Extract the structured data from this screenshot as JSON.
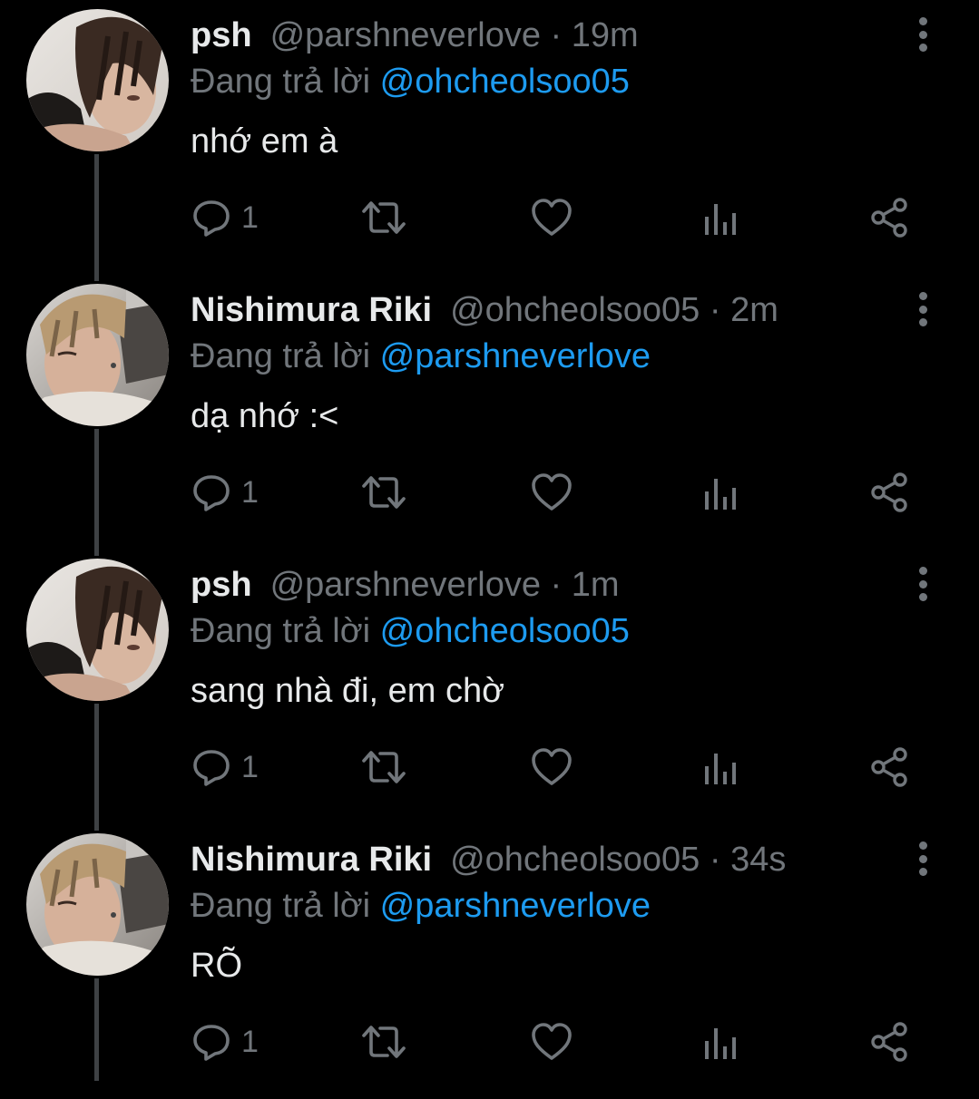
{
  "tweets": [
    {
      "display_name": "psh",
      "handle": "@parshneverlove",
      "separator": "·",
      "time": "19m",
      "reply_prefix": "Đang trả lời",
      "reply_to": "@ohcheolsoo05",
      "text": "nhớ em à",
      "reply_count": "1",
      "avatar": "psh-avatar"
    },
    {
      "display_name": "Nishimura Riki",
      "handle": "@ohcheolsoo05",
      "separator": "·",
      "time": "2m",
      "reply_prefix": "Đang trả lời",
      "reply_to": "@parshneverlove",
      "text": "dạ nhớ :<",
      "reply_count": "1",
      "avatar": "riki-avatar"
    },
    {
      "display_name": "psh",
      "handle": "@parshneverlove",
      "separator": "·",
      "time": "1m",
      "reply_prefix": "Đang trả lời",
      "reply_to": "@ohcheolsoo05",
      "text": "sang nhà đi, em chờ",
      "reply_count": "1",
      "avatar": "psh-avatar"
    },
    {
      "display_name": "Nishimura Riki",
      "handle": "@ohcheolsoo05",
      "separator": "·",
      "time": "34s",
      "reply_prefix": "Đang trả lời",
      "reply_to": "@parshneverlove",
      "text": "RÕ",
      "reply_count": "1",
      "avatar": "riki-avatar"
    }
  ],
  "icons": {
    "reply": "speech-bubble-icon",
    "retweet": "retweet-icon",
    "like": "heart-icon",
    "views": "bar-chart-icon",
    "share": "share-icon",
    "more": "vertical-dots-icon"
  },
  "colors": {
    "background": "#000000",
    "primary_text": "#e7e9ea",
    "secondary_text": "#71767b",
    "mention": "#1d9bf0",
    "thread_line": "#3e4144"
  }
}
